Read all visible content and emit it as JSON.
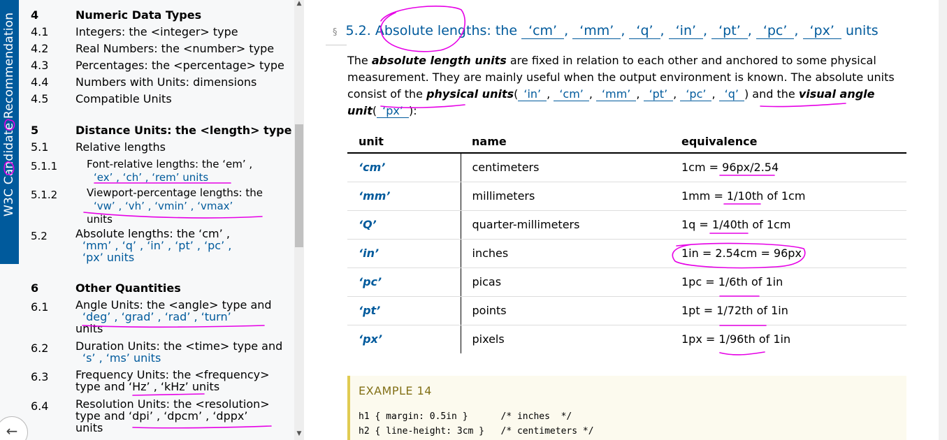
{
  "sidebar": {
    "banner": "W3C Candidate Recommendation",
    "sections": [
      {
        "num": "4",
        "title": "Numeric Data Types"
      },
      {
        "num": "5",
        "title": "Distance Units: the <length> type"
      },
      {
        "num": "6",
        "title": "Other Quantities"
      }
    ],
    "items": [
      {
        "num": "4.1",
        "text": "Integers: the <integer> type"
      },
      {
        "num": "4.2",
        "text": "Real Numbers: the <number> type"
      },
      {
        "num": "4.3",
        "text": "Percentages: the <percentage> type"
      },
      {
        "num": "4.4",
        "text": "Numbers with Units: dimensions"
      },
      {
        "num": "4.5",
        "text": "Compatible Units"
      },
      {
        "num": "5.1",
        "text": "Relative lengths"
      },
      {
        "num": "5.1.1",
        "line1": "Font-relative lengths: the  ‘em’ ,",
        "line2": "‘ex’ ,  ‘ch’ ,  ‘rem’  units"
      },
      {
        "num": "5.1.2",
        "line1": "Viewport-percentage lengths: the",
        "line2": "‘vw’ ,  ‘vh’ ,  ‘vmin’ ,  ‘vmax’",
        "line3": "units"
      },
      {
        "num": "5.2",
        "line1": "Absolute lengths: the  ‘cm’ ,",
        "line2": "‘mm’ ,  ‘q’ ,  ‘in’ ,  ‘pt’ ,  ‘pc’ ,",
        "line3": "‘px’  units"
      },
      {
        "num": "6.1",
        "line1": "Angle Units: the <angle> type and",
        "line2": "‘deg’ ,  ‘grad’ ,  ‘rad’ ,  ‘turn’",
        "line3": "units"
      },
      {
        "num": "6.2",
        "line1": "Duration Units: the <time> type and",
        "line2": "‘s’ ,  ‘ms’  units"
      },
      {
        "num": "6.3",
        "line1": "Frequency Units: the <frequency>",
        "line2": "type and  ‘Hz’ ,  ‘kHz’  units"
      },
      {
        "num": "6.4",
        "line1": "Resolution Units: the <resolution>",
        "line2": "type and  ‘dpi’ ,  ‘dpcm’ ,  ‘dppx’",
        "line3": "units"
      }
    ],
    "back_icon": "arrow-left-icon"
  },
  "main": {
    "section_mark": "§",
    "heading_prefix": "5.2. Absolute lengths: the",
    "heading_units": [
      "‘cm’",
      "‘mm’",
      "‘q’",
      "‘in’",
      "‘pt’",
      "‘pc’",
      "‘px’"
    ],
    "heading_suffix": "units",
    "para": {
      "t1": "The ",
      "b1": "absolute length units",
      "t2": " are fixed in relation to each other and anchored to some physical measurement. They are mainly useful when the output environment is known. The absolute units consist of the ",
      "b2": "physical units",
      "phys_units": [
        "‘in’",
        "‘cm’",
        "‘mm’",
        "‘pt’",
        "‘pc’",
        "‘q’"
      ],
      "t3": " and the ",
      "b3": "visual angle unit",
      "visual_unit": "‘px’",
      "t4": ":"
    },
    "table": {
      "headers": [
        "unit",
        "name",
        "equivalence"
      ],
      "rows": [
        {
          "unit": "‘cm’",
          "name": "centimeters",
          "eq": "1cm = 96px/2.54"
        },
        {
          "unit": "‘mm’",
          "name": "millimeters",
          "eq": "1mm = 1/10th of 1cm"
        },
        {
          "unit": "‘Q’",
          "name": "quarter-millimeters",
          "eq": "1q = 1/40th of 1cm"
        },
        {
          "unit": "‘in’",
          "name": "inches",
          "eq": "1in = 2.54cm = 96px"
        },
        {
          "unit": "‘pc’",
          "name": "picas",
          "eq": "1pc = 1/6th of 1in"
        },
        {
          "unit": "‘pt’",
          "name": "points",
          "eq": "1pt = 1/72th of 1in"
        },
        {
          "unit": "‘px’",
          "name": "pixels",
          "eq": "1px = 1/96th of 1in"
        }
      ]
    },
    "example": {
      "title": "EXAMPLE 14",
      "code": [
        "h1 { margin: 0.5in }      /* inches  */",
        "h2 { line-height: 3cm }   /* centimeters */"
      ]
    }
  },
  "colors": {
    "link": "#005a9c",
    "band": "#005a9c",
    "annotation": "#e600e6",
    "example_border": "#e0cb52"
  }
}
